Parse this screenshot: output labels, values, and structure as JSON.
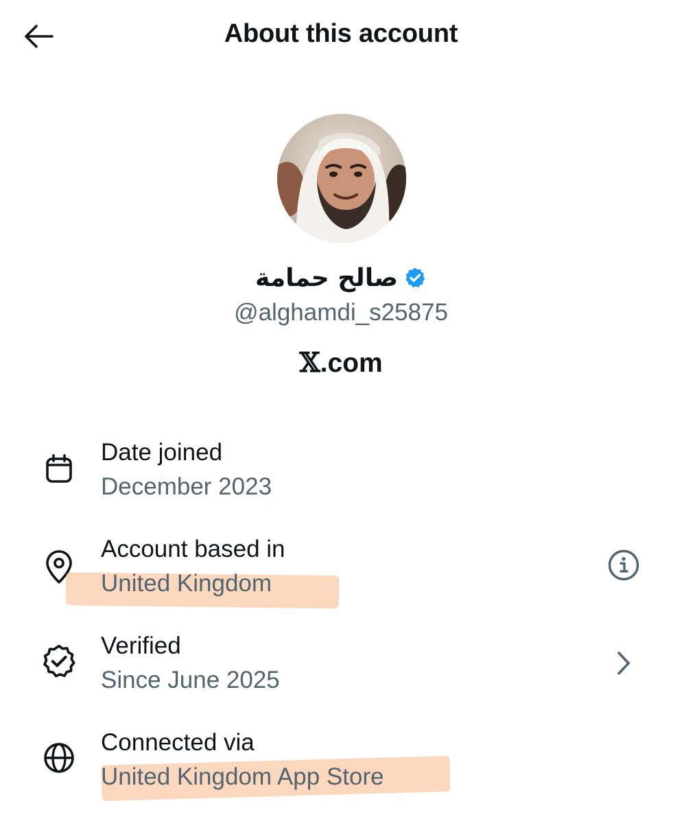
{
  "header": {
    "title": "About this account",
    "back_icon": "arrow-left-icon"
  },
  "profile": {
    "avatar_alt": "profile-photo",
    "display_name": "صالح حمامة",
    "verified_icon": "verified-badge-icon",
    "verified_color": "#1d9bf0",
    "handle": "@alghamdi_s25875",
    "platform_x": "𝕏",
    "platform_suffix": ".com"
  },
  "details": [
    {
      "icon": "calendar-icon",
      "label": "Date joined",
      "value": "December 2023"
    },
    {
      "icon": "location-pin-icon",
      "label": "Account based in",
      "value": "United Kingdom",
      "trailing_icon": "info-icon",
      "highlighted": true
    },
    {
      "icon": "verified-outline-icon",
      "label": "Verified",
      "value": "Since June 2025",
      "trailing_icon": "chevron-right-icon"
    },
    {
      "icon": "globe-icon",
      "label": "Connected via",
      "value": "United Kingdom App Store",
      "highlighted": true
    }
  ],
  "colors": {
    "text_primary": "#0f1419",
    "text_secondary": "#536471",
    "highlight": "#f9be96"
  }
}
